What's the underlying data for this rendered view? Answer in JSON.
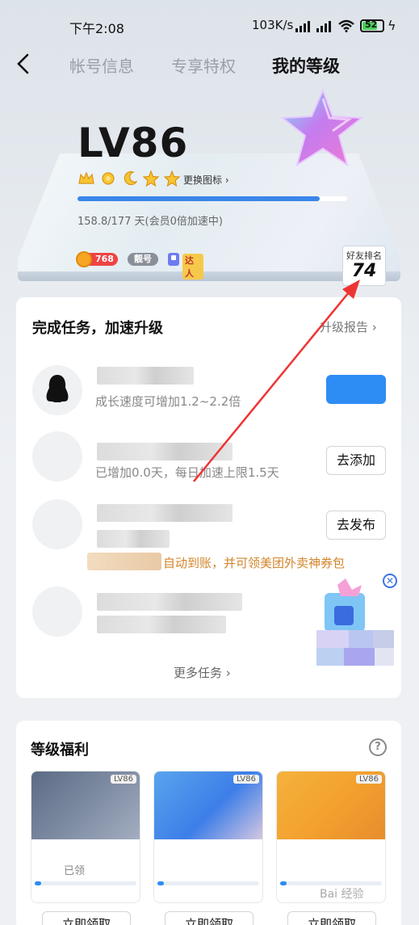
{
  "status_bar": {
    "time": "下午2:08",
    "network": "103K/s",
    "battery": "52"
  },
  "nav": {
    "tabs": [
      "帐号信息",
      "专享特权",
      "我的等级"
    ],
    "active_tab": "我的等级"
  },
  "level_card": {
    "level": "LV86",
    "change_icon_label": "更换图标 ›",
    "progress_fraction": 0.897,
    "days_text": "158.8/177 天(会员0倍加速中)",
    "coin_count": "768",
    "pretty_label": "靓号",
    "talent_label": "达人",
    "friend_rank_label": "好友排名",
    "friend_rank_value": "74"
  },
  "tasks": {
    "title": "完成任务，加速升级",
    "report_link": "升级报告 ›",
    "items": [
      {
        "desc": "成长速度可增加1.2~2.2倍",
        "button": ""
      },
      {
        "desc": "已增加0.0天，每日加速上限1.5天",
        "button": "去添加"
      },
      {
        "desc": "",
        "button": "去发布"
      },
      {
        "desc": "",
        "button": ""
      }
    ],
    "promo": "自动到账，并可领美团外卖神券包",
    "more": "更多任务 ›"
  },
  "benefits": {
    "title": "等级福利",
    "help": "?",
    "items": [
      {
        "lv": "LV86",
        "sub": "已领",
        "button": "立即领取"
      },
      {
        "lv": "LV86",
        "sub": "",
        "button": "立即领取"
      },
      {
        "lv": "LV86",
        "sub": "",
        "button": "立即领取"
      }
    ]
  },
  "watermark": "Bai 经验"
}
